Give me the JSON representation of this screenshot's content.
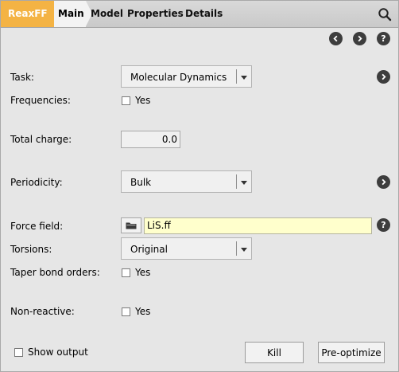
{
  "tabs": {
    "engine": "ReaxFF",
    "main": "Main",
    "model": "Model",
    "properties": "Properties",
    "details": "Details"
  },
  "form": {
    "task_label": "Task:",
    "task_value": "Molecular Dynamics",
    "frequencies_label": "Frequencies:",
    "frequencies_option": "Yes",
    "total_charge_label": "Total charge:",
    "total_charge_value": "0.0",
    "periodicity_label": "Periodicity:",
    "periodicity_value": "Bulk",
    "force_field_label": "Force field:",
    "force_field_value": "LiS.ff",
    "torsions_label": "Torsions:",
    "torsions_value": "Original",
    "taper_label": "Taper bond orders:",
    "taper_option": "Yes",
    "nonreactive_label": "Non-reactive:",
    "nonreactive_option": "Yes"
  },
  "footer": {
    "show_output": "Show output",
    "kill": "Kill",
    "preoptimize": "Pre-optimize"
  },
  "help_glyph": "?",
  "colors": {
    "engine_tab": "#f4b344",
    "force_field_bg": "#ffffcc",
    "panel_bg": "#e6e6e6",
    "icon_dark": "#3d3d3d"
  }
}
